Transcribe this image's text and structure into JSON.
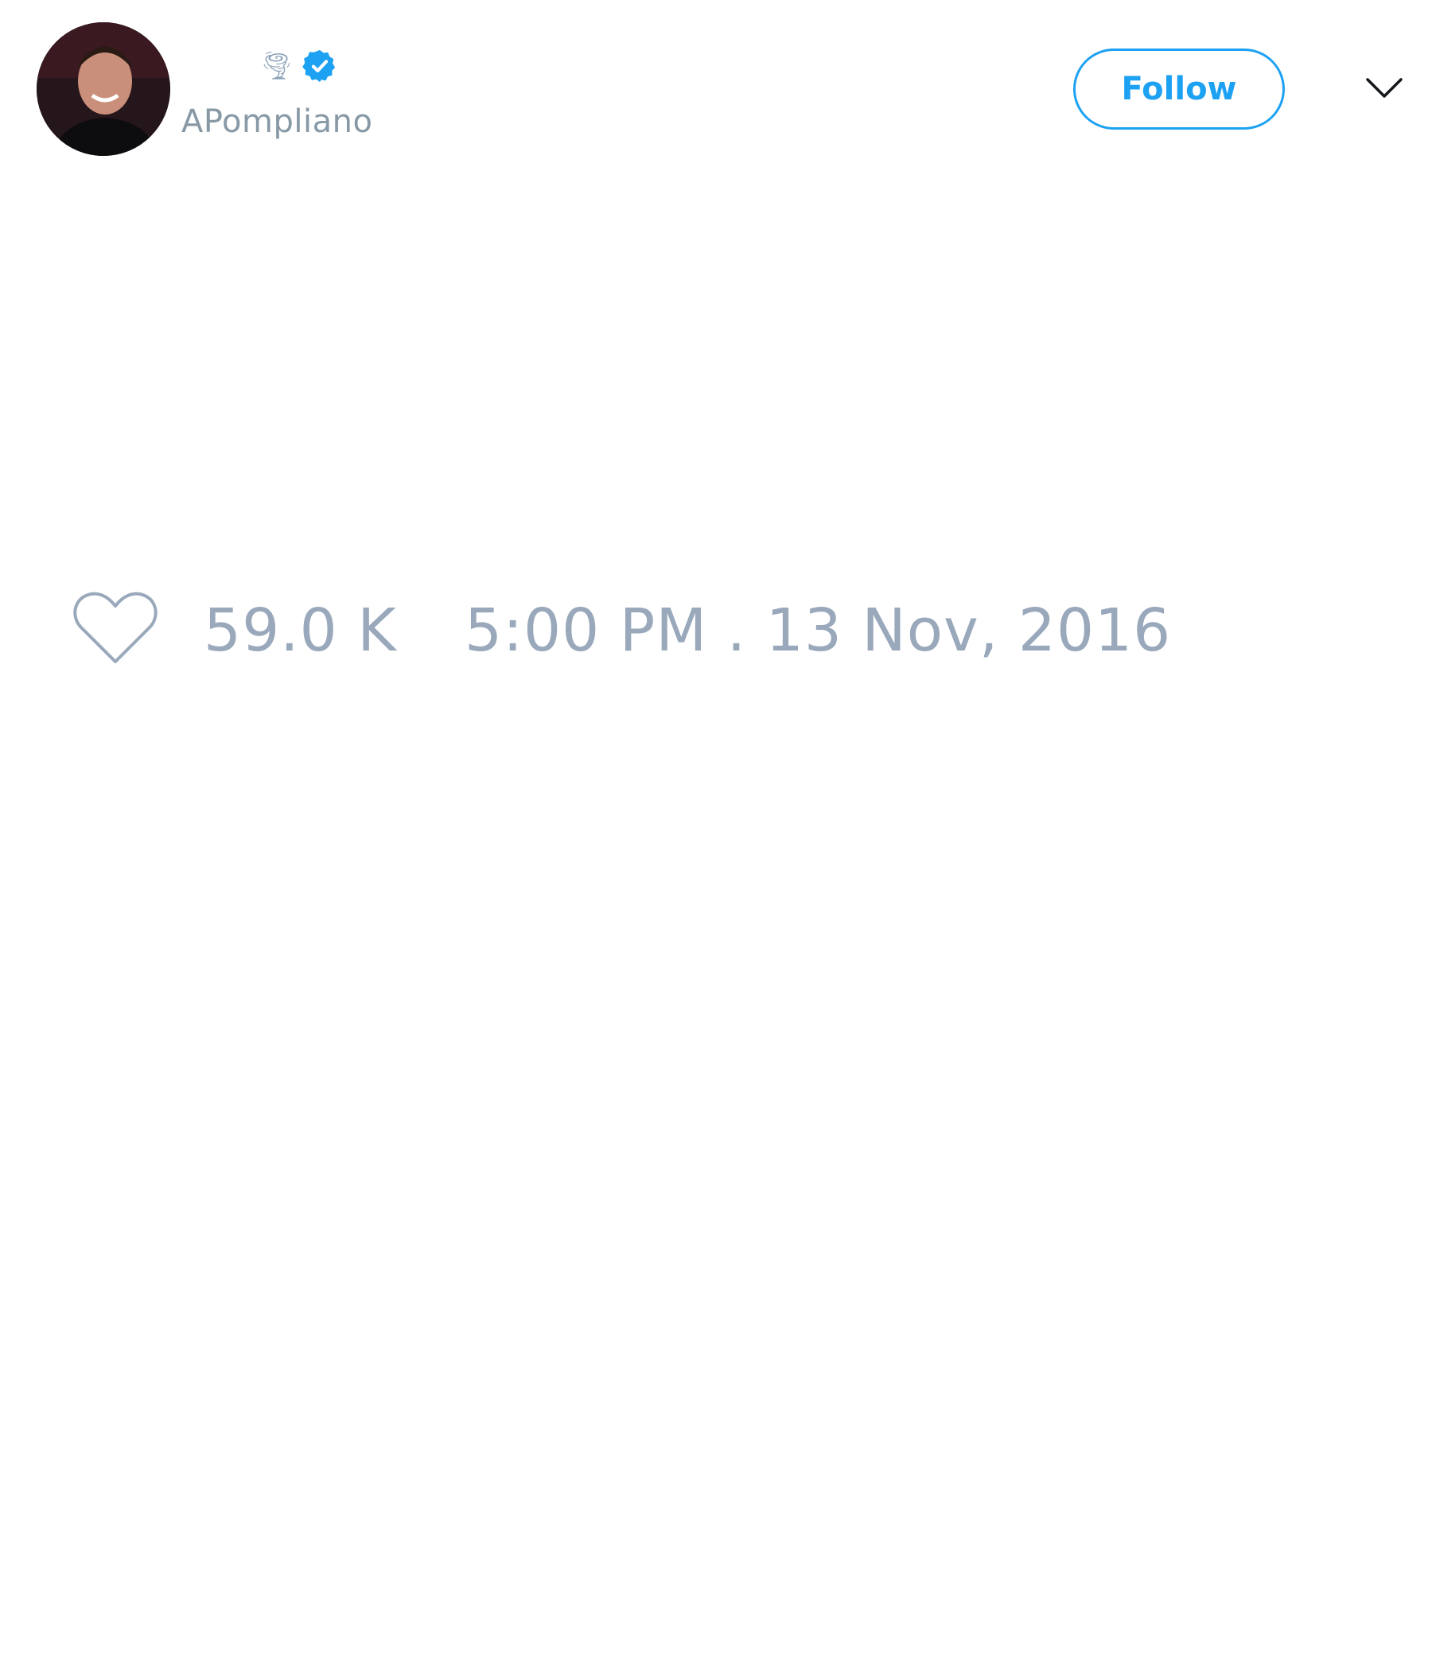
{
  "tweet": {
    "author": {
      "name_emoji": "🌪",
      "verified": true,
      "handle": "APompliano"
    },
    "actions": {
      "follow_label": "Follow",
      "menu_icon": "chevron-down-icon"
    },
    "stats": {
      "like_icon": "heart-icon",
      "like_count": "59.0 K",
      "timestamp": "5:00 PM . 13 Nov, 2016"
    }
  },
  "colors": {
    "accent": "#1da1f2",
    "muted_text": "#99a8bb",
    "handle_text": "#8899a6",
    "background": "#ffffff"
  }
}
